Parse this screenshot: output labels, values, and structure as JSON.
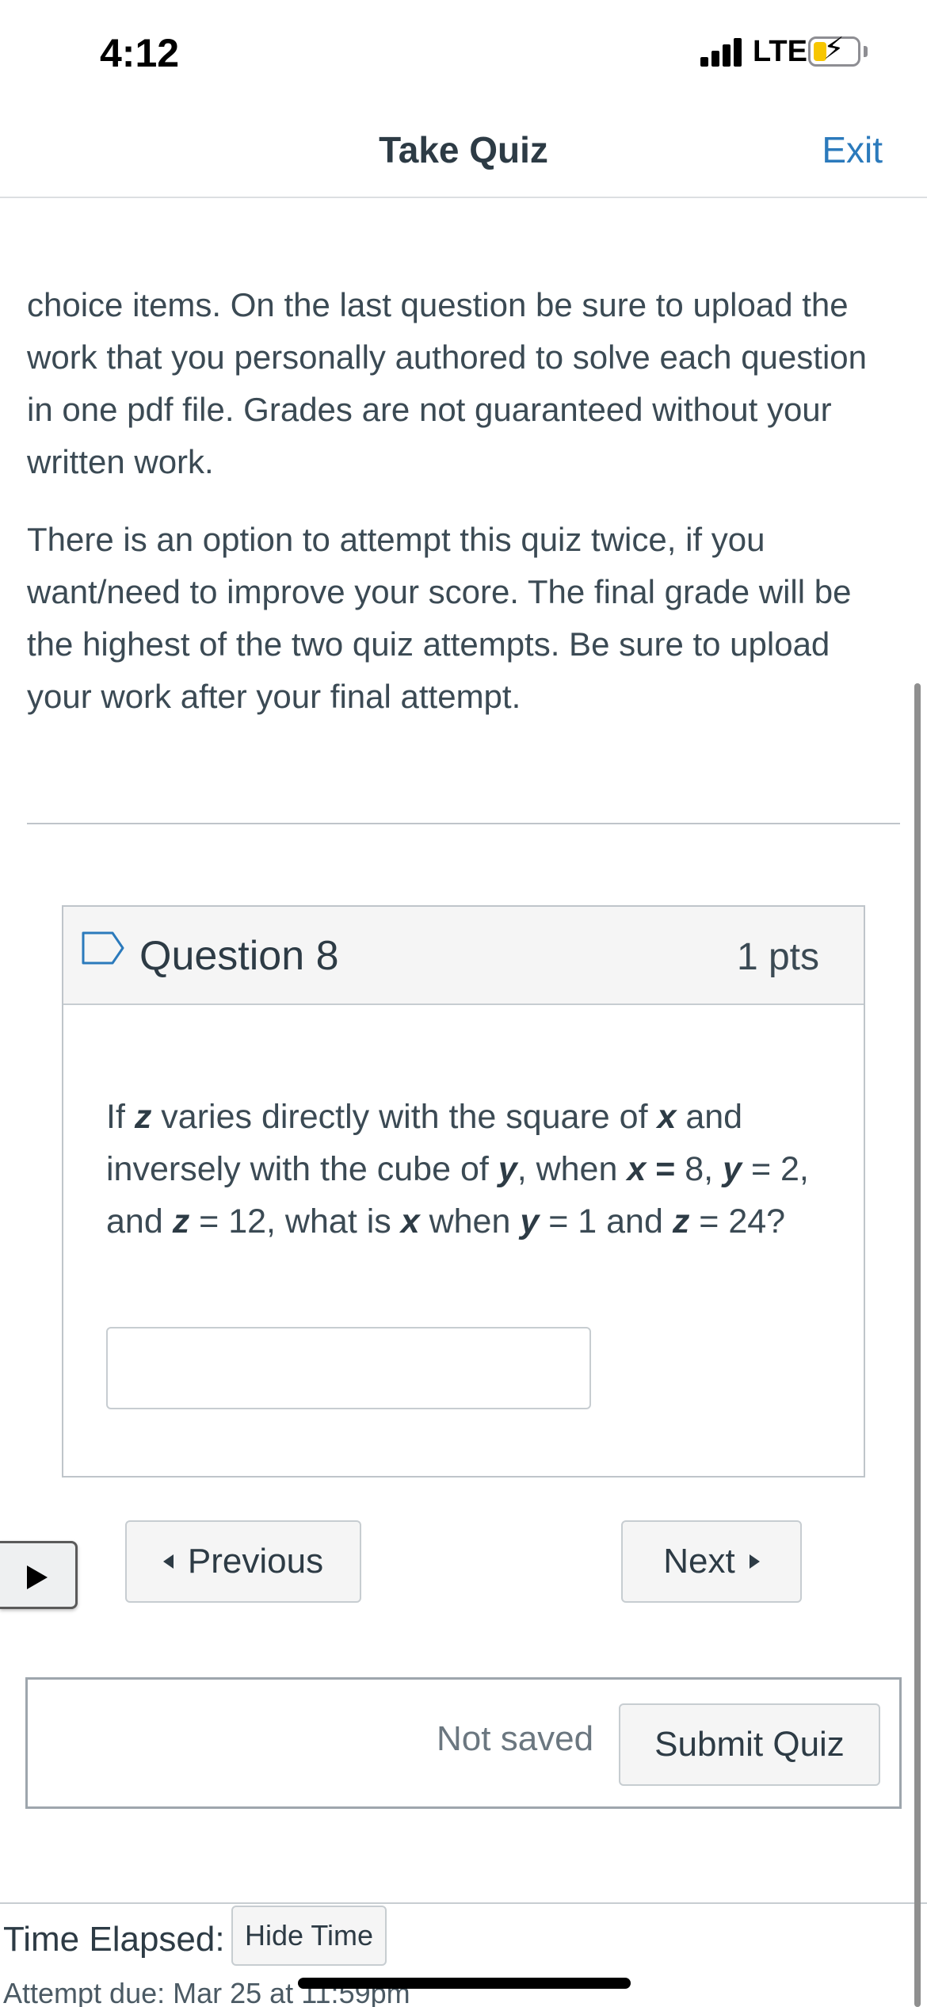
{
  "status_bar": {
    "time": "4:12",
    "network": "LTE",
    "icons": [
      "signal-icon",
      "battery-charging-icon"
    ],
    "battery_fill_color": "#f7c600"
  },
  "header": {
    "title": "Take Quiz",
    "exit_label": "Exit",
    "accent_color": "#2b7abc"
  },
  "instructions": {
    "paragraph_1": "choice items.  On the last question be sure to upload the work that you personally authored to solve each question in one pdf file.  Grades are not guaranteed without your written work.",
    "paragraph_2": "There is an option to attempt this quiz twice, if you want/need to improve your score.  The final grade will be the highest of the two quiz attempts.  Be sure to upload your work after your final attempt."
  },
  "question": {
    "title": "Question 8",
    "points": "1 pts",
    "flag_icon": "flag-outline-icon",
    "text_parts": {
      "p1": "If ",
      "z1": "z",
      "p2": " varies directly with the square of ",
      "x1": "x",
      "p3": " and inversely with the cube of ",
      "y1": "y",
      "p4": ", when ",
      "x2": "x",
      "eq1": " = ",
      "p5": "8, ",
      "y2": "y",
      "p6": " = 2, and ",
      "z2": "z",
      "p7": " = 12, what is ",
      "x3": "x",
      "p8": " when ",
      "y3": "y",
      "p9": " = 1 and ",
      "z3": "z",
      "p10": " = 24?"
    },
    "answer_value": ""
  },
  "navigation": {
    "previous_label": "Previous",
    "next_label": "Next",
    "play_icon": "play-icon"
  },
  "submit": {
    "status_text": "Not saved",
    "submit_label": "Submit Quiz"
  },
  "footer": {
    "time_label": "Time Elapsed:",
    "hide_time_label": "Hide Time",
    "due_text": "Attempt due: Mar 25 at 11:59pm"
  }
}
